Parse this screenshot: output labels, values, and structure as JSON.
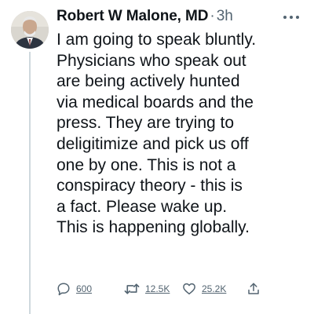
{
  "author": {
    "name": "Robert W Malone, MD",
    "separator": "·",
    "timestamp": "3h"
  },
  "more_icon": "more-horizontal-icon",
  "tweet": {
    "lines": [
      "I am going to speak bluntly.",
      "Physicians who speak out",
      "are being actively hunted",
      "via medical boards and the",
      "press.  They are trying to",
      "deligitimize and pick us off",
      "one by one.  This is not a",
      "conspiracy theory - this is",
      "a fact. Please wake up.",
      "This is happening globally."
    ]
  },
  "actions": {
    "reply": {
      "icon": "reply-icon",
      "count": "600"
    },
    "retweet": {
      "icon": "retweet-icon",
      "count": "12.5K"
    },
    "like": {
      "icon": "heart-icon",
      "count": "25.2K"
    },
    "share": {
      "icon": "share-icon"
    }
  },
  "colors": {
    "text": "#0f1419",
    "secondary": "#536471",
    "thread_line": "#cfd9de"
  }
}
